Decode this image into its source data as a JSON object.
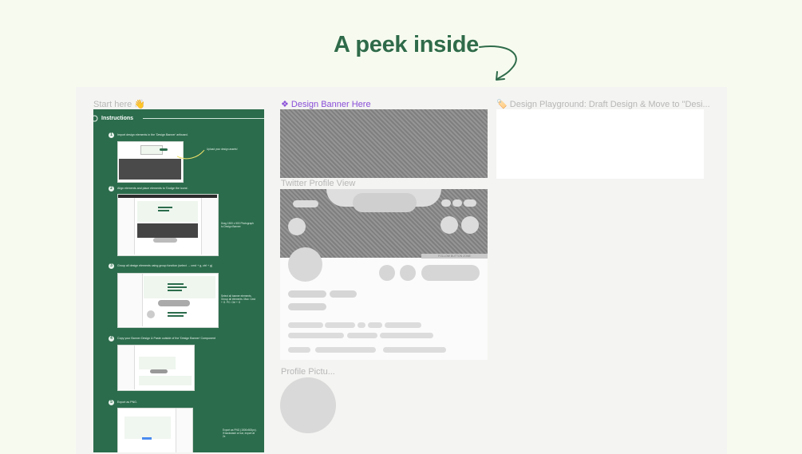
{
  "headline": "A peek inside",
  "frames": {
    "start_label": "Start here 👋",
    "banner_label": "❖ Design Banner Here",
    "playground_label": "🏷️ Design Playground: Draft Design & Move to \"Desi...",
    "twitter_label": "Twitter Profile View",
    "profile_label": "Profile Pictu...",
    "follow_button_text": "FOLLOW BUTTON ZONE"
  },
  "instructions": {
    "title": "Instructions",
    "steps": [
      {
        "num": "1",
        "text": "Import design elements in the 'Design Banner' artboard."
      },
      {
        "num": "2",
        "text": "Align elements and place elements to 'Dodge the icons'."
      },
      {
        "num": "3",
        "text": "Group all design elements using group function (select → cmd + g, ctrl + g)"
      },
      {
        "num": "4",
        "text": "Copy your Banner Design & Paste outside of the 'Design Banner' Component"
      },
      {
        "num": "5",
        "text": "Export as PNG."
      }
    ],
    "notes": {
      "upload": "Upload your design assets!",
      "size": "Drag 1500 x 500 Photograph to Design Banner",
      "group": "Select all banner elements. Group all elements. Mac: Cmd + G. PC: Ctrl + G",
      "export": "Export as PNG (1500x500px). If backslash or bar, export at 2x"
    }
  }
}
